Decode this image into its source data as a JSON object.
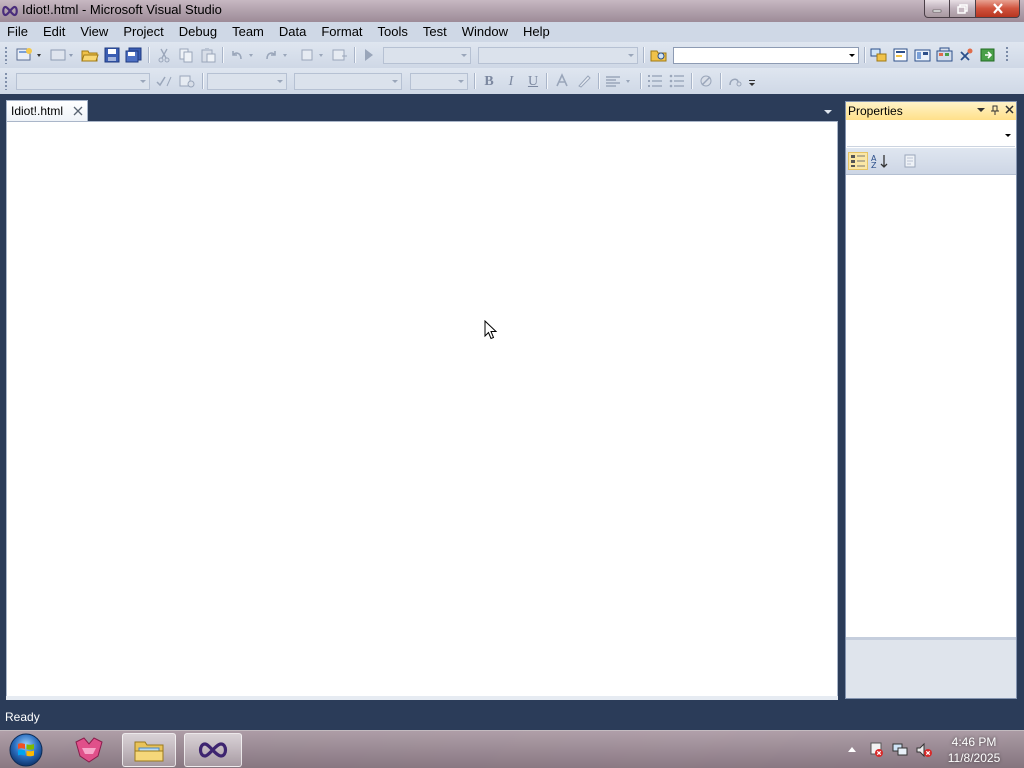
{
  "window": {
    "title": "Idiot!.html - Microsoft Visual Studio"
  },
  "menu": {
    "items": [
      "File",
      "Edit",
      "View",
      "Project",
      "Debug",
      "Team",
      "Data",
      "Format",
      "Tools",
      "Test",
      "Window",
      "Help"
    ]
  },
  "document": {
    "tab_label": "Idiot!.html"
  },
  "properties": {
    "title": "Properties"
  },
  "status": {
    "text": "Ready"
  },
  "clock": {
    "time": "4:46 PM",
    "date": "11/8/2025"
  },
  "formatting": {
    "bold": "B",
    "italic": "I",
    "underline": "U"
  },
  "icons": {
    "app": "infinity-logo-icon",
    "start": "windows-orb-icon",
    "taskbar": [
      "tool-icon",
      "file-explorer-icon",
      "visual-studio-icon"
    ],
    "tray": [
      "action-center-icon",
      "network-icon",
      "volume-muted-icon"
    ]
  },
  "colors": {
    "chrome": "#2b3c59",
    "toolbar": "#cfd8e6",
    "tab_active_title": "#ffe08a"
  }
}
